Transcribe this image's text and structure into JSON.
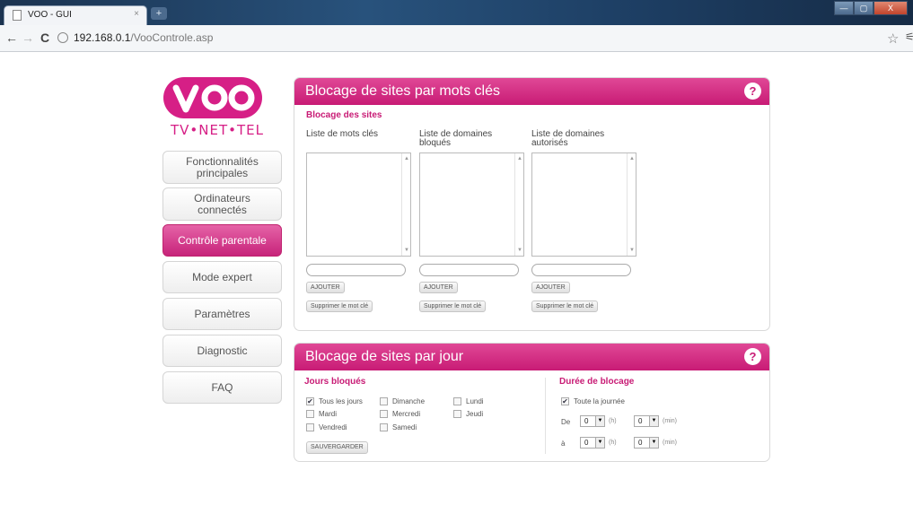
{
  "browser": {
    "tab_title": "VOO - GUI",
    "tab_close": "×",
    "new_tab": "+",
    "url_host": "192.168.0.1",
    "url_path": "/VooControle.asp",
    "back": "←",
    "forward": "→",
    "reload": "C",
    "star": "☆",
    "menu": "⚟",
    "win_min": "—",
    "win_max": "▢",
    "win_close": "X"
  },
  "logo": {
    "brand": "VOO",
    "tagline": "TV•NET•TEL",
    "color": "#d61f86"
  },
  "menu": {
    "items": [
      {
        "label": "Fonctionnalités principales",
        "active": false
      },
      {
        "label": "Ordinateurs connectés",
        "active": false
      },
      {
        "label": "Contrôle parentale",
        "active": true
      },
      {
        "label": "Mode expert",
        "active": false
      },
      {
        "label": "Paramètres",
        "active": false
      },
      {
        "label": "Diagnostic",
        "active": false
      },
      {
        "label": "FAQ",
        "active": false
      }
    ]
  },
  "keyword_panel": {
    "title": "Blocage de sites par mots clés",
    "help": "?",
    "section": "Blocage des sites",
    "columns": [
      {
        "label": "Liste de mots clés",
        "add": "AJOUTER",
        "remove": "Supprimer le mot clé"
      },
      {
        "label": "Liste de domaines bloqués",
        "add": "AJOUTER",
        "remove": "Supprimer le mot clé"
      },
      {
        "label": "Liste de domaines autorisés",
        "add": "AJOUTER",
        "remove": "Supprimer le mot clé"
      }
    ]
  },
  "day_panel": {
    "title": "Blocage de sites par jour",
    "help": "?",
    "days_heading": "Jours bloqués",
    "days": [
      {
        "label": "Tous les jours",
        "checked": true
      },
      {
        "label": "Dimanche",
        "checked": false
      },
      {
        "label": "Lundi",
        "checked": false
      },
      {
        "label": "Mardi",
        "checked": false
      },
      {
        "label": "Mercredi",
        "checked": false
      },
      {
        "label": "Jeudi",
        "checked": false
      },
      {
        "label": "Vendredi",
        "checked": false
      },
      {
        "label": "Samedi",
        "checked": false
      }
    ],
    "save": "SAUVERGARDER",
    "duration_heading": "Durée de blocage",
    "all_day": {
      "label": "Toute la journée",
      "checked": true
    },
    "from_label": "De",
    "to_label": "à",
    "from_hour": "0",
    "from_min": "0",
    "to_hour": "0",
    "to_min": "0",
    "hour_unit": "(h)",
    "min_unit": "(min)"
  },
  "colors": {
    "accent": "#c81b75",
    "accent_light": "#e04896"
  }
}
